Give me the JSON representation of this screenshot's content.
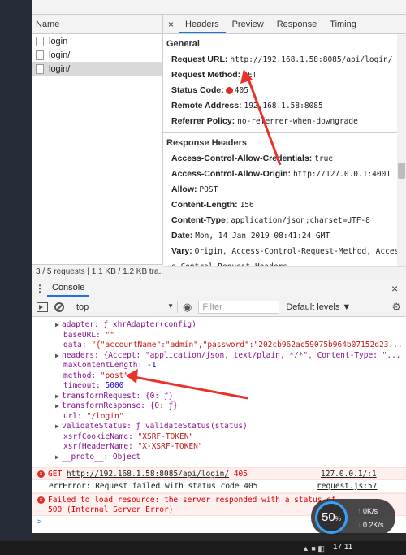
{
  "network_list": {
    "header": "Name",
    "rows": [
      "login",
      "login/",
      "login/"
    ],
    "status": "3 / 5 requests | 1.1 KB / 1.2 KB tra..."
  },
  "tabs": {
    "close": "×",
    "items": [
      "Headers",
      "Preview",
      "Response",
      "Timing"
    ]
  },
  "general": {
    "title": "General",
    "request_url": {
      "k": "Request URL:",
      "v": "http://192.168.1.58:8085/api/login/"
    },
    "request_method": {
      "k": "Request Method:",
      "v": "GET"
    },
    "status_code": {
      "k": "Status Code:",
      "v": "405"
    },
    "remote_address": {
      "k": "Remote Address:",
      "v": "192.168.1.58:8085"
    },
    "referrer_policy": {
      "k": "Referrer Policy:",
      "v": "no-referrer-when-downgrade"
    }
  },
  "response_headers": {
    "title": "Response Headers",
    "rows": [
      {
        "k": "Access-Control-Allow-Credentials:",
        "v": "true"
      },
      {
        "k": "Access-Control-Allow-Origin:",
        "v": "http://127.0.0.1:4001"
      },
      {
        "k": "Allow:",
        "v": "POST"
      },
      {
        "k": "Content-Length:",
        "v": "156"
      },
      {
        "k": "Content-Type:",
        "v": "application/json;charset=UTF-8"
      },
      {
        "k": "Date:",
        "v": "Mon, 14 Jan 2019 08:41:24 GMT"
      },
      {
        "k": "Vary:",
        "v": "Origin, Access-Control-Request-Method, Acces"
      },
      {
        "k": "",
        "v": "s-Control-Request-Headers"
      }
    ]
  },
  "console": {
    "tab": "Console",
    "close": "×",
    "context": "top",
    "filter_placeholder": "Filter",
    "levels": "Default levels ▼",
    "lines": {
      "adapter": "adapter: ƒ xhrAdapter(config)",
      "baseURL_k": "baseURL:",
      "baseURL_v": "\"\"",
      "data_k": "data:",
      "data_v": "\"{\"accountName\":\"admin\",\"password\":\"202cb962ac59075b964b07152d23...",
      "headers": "headers: {Accept: \"application/json, text/plain, */*\", Content-Type: \"...",
      "maxlen_k": "maxContentLength:",
      "maxlen_v": "-1",
      "method_k": "method:",
      "method_v": "\"post\"",
      "timeout_k": "timeout:",
      "timeout_v": "5000",
      "transformRequest": "transformRequest: {0: ƒ}",
      "transformResponse": "transformResponse: {0: ƒ}",
      "url_k": "url:",
      "url_v": "\"/login\"",
      "validateStatus": "validateStatus: ƒ validateStatus(status)",
      "xsrfCookie_k": "xsrfCookieName:",
      "xsrfCookie_v": "\"XSRF-TOKEN\"",
      "xsrfHeader_k": "xsrfHeaderName:",
      "xsrfHeader_v": "\"X-XSRF-TOKEN\"",
      "proto": "__proto__: Object"
    },
    "errors": [
      {
        "method": "GET",
        "url": "http://192.168.1.58:8085/api/login/",
        "code": "405",
        "source": "127.0.0.1/:1"
      },
      {
        "text": "errError: Request failed with status code 405",
        "source": "request.js:57"
      },
      {
        "text": "Failed to load resource: the server responded with a status of",
        "text2": "500 (Internal Server Error)"
      }
    ],
    "prompt": ">"
  },
  "speed_widget": {
    "percent": "50",
    "pct_sign": "%",
    "up": "0K/s",
    "down": "0.2K/s"
  },
  "taskbar": {
    "time": "17:11"
  },
  "colors": {
    "accent": "#1a73e8",
    "error": "#d93025",
    "arrow": "#e8322a"
  }
}
